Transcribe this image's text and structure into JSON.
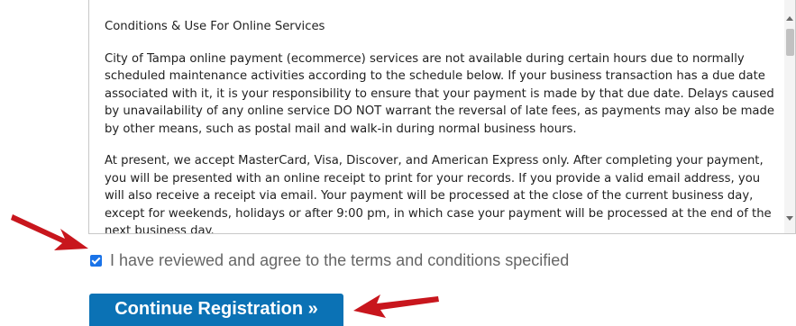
{
  "terms": {
    "title": "Conditions & Use For Online Services",
    "paragraphs": [
      "City of Tampa online payment (ecommerce) services are not available during certain hours due to normally scheduled maintenance activities according to the schedule below. If your business transaction has a due date associated with it, it is your responsibility to ensure that your payment is made by that due date. Delays caused by unavailability of any online service DO NOT warrant the reversal of late fees, as payments may also be made by other means, such as postal mail and walk-in during normal business hours.",
      "At present, we accept MasterCard, Visa, Discover, and American Express only. After completing your payment, you will be presented with an online receipt to print for your records. If you provide a valid email address, you will also receive a receipt via email. Your payment will be processed at the close of the current business day, except for weekends, holidays or after 9:00 pm, in which case your payment will be processed at the end of the next business day."
    ]
  },
  "agreement": {
    "label": "I have reviewed and agree to the terms and conditions specified",
    "checked": true
  },
  "continue_button": {
    "label": "Continue Registration »"
  },
  "colors": {
    "button_bg": "#0b72b5",
    "arrow": "#c8161d",
    "checkbox": "#1a73e8"
  },
  "icons": {
    "checkbox": "checkmark-icon",
    "arrow_1": "red-arrow-icon",
    "arrow_2": "red-arrow-icon",
    "scroll_up": "chevron-up-icon",
    "scroll_down": "chevron-down-icon"
  }
}
